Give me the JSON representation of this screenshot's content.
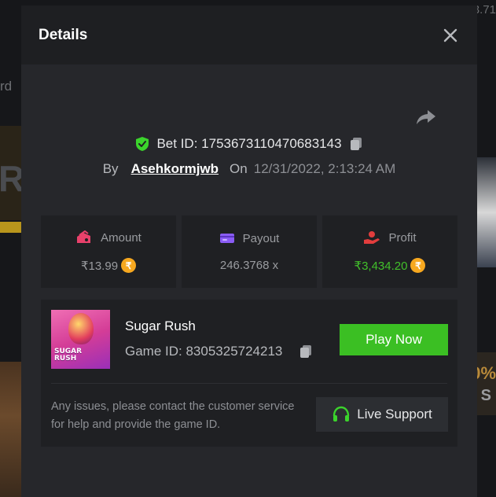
{
  "background": {
    "left_text": "rd",
    "left_big": "R(",
    "right_top": "3.71",
    "right_promo_1": "0%",
    "right_promo_2": "S"
  },
  "modal": {
    "title": "Details",
    "bet_id_label": "Bet ID: 1753673110470683143",
    "by_label": "By",
    "username": "Asehkormjwb",
    "on_label": "On",
    "datetime": "12/31/2022, 2:13:24 AM",
    "stats": [
      {
        "label": "Amount",
        "value": "₹13.99",
        "icon": "wallet-money-icon",
        "icon_color": "#e8416b",
        "has_coin": true
      },
      {
        "label": "Payout",
        "value": "246.3768 x",
        "icon": "card-icon",
        "icon_color": "#8a5cf5",
        "has_coin": false
      },
      {
        "label": "Profit",
        "value": "₹3,434.20",
        "icon": "hand-coin-icon",
        "icon_color": "#e23d3d",
        "has_coin": true,
        "value_color": "#42c02b"
      }
    ],
    "coin_symbol": "₹",
    "game": {
      "title": "Sugar Rush",
      "thumb_text_1": "SUGAR",
      "thumb_text_2": "RUSH",
      "game_id_label": "Game ID: 8305325724213",
      "play_label": "Play Now",
      "issues_text": "Any issues, please contact the customer service for help and provide the game ID.",
      "support_label": "Live Support"
    }
  },
  "colors": {
    "accent_green": "#3bbf23",
    "shield_green": "#3bd42c",
    "coin_orange": "#f7a81f"
  }
}
